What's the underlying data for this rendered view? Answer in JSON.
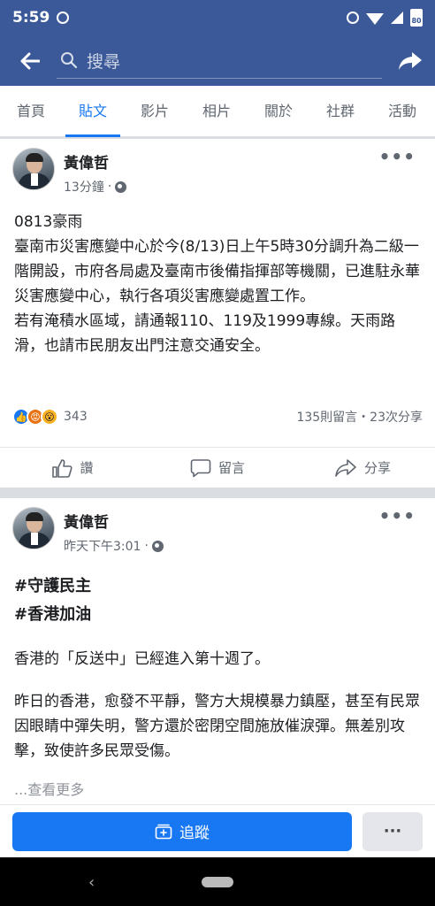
{
  "status_bar": {
    "time": "5:59",
    "battery": "80"
  },
  "header": {
    "search_placeholder": "搜尋"
  },
  "tabs": [
    {
      "label": "首頁",
      "active": false
    },
    {
      "label": "貼文",
      "active": true
    },
    {
      "label": "影片",
      "active": false
    },
    {
      "label": "相片",
      "active": false
    },
    {
      "label": "關於",
      "active": false
    },
    {
      "label": "社群",
      "active": false
    },
    {
      "label": "活動",
      "active": false
    }
  ],
  "posts": [
    {
      "author": "黃偉哲",
      "time": "13分鐘",
      "separator": "·",
      "lines": [
        "0813豪雨",
        "臺南市災害應變中心於今(8/13)日上午5時30分調升為二級一階開設，市府各局處及臺南市後備指揮部等機關，已進駐永華災害應變中心，執行各項災害應變處置工作。",
        "若有淹積水區域，請通報110、119及1999專線。天雨路滑，也請市民朋友出門注意交通安全。"
      ],
      "reaction_count": "343",
      "stats": "135則留言・23次分享",
      "actions": {
        "like": "讚",
        "comment": "留言",
        "share": "分享"
      }
    },
    {
      "author": "黃偉哲",
      "time": "昨天下午3:01",
      "separator": "·",
      "hashtags": [
        "#守護民主",
        "#香港加油"
      ],
      "paragraphs": [
        "香港的「反送中」已經進入第十週了。",
        "昨日的香港，愈發不平靜，警方大規模暴力鎮壓，甚至有民眾因眼睛中彈失明，警方還於密閉空間施放催淚彈。無差別攻擊，致使許多民眾受傷。"
      ],
      "see_more": "...查看更多"
    }
  ],
  "footer": {
    "follow_label": "追蹤",
    "more_label": "···"
  },
  "colors": {
    "brand": "#3b5998",
    "accent": "#1877f2"
  }
}
